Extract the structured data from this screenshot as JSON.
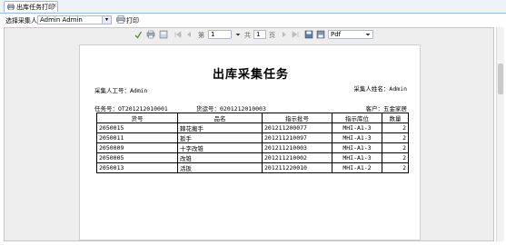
{
  "tab": {
    "label": "出库任务打印",
    "close": "×"
  },
  "filter": {
    "label": "选择采集人",
    "value": "Admin Admin",
    "arrow": "▾",
    "print_label": "打印"
  },
  "viewer_toolbar": {
    "page_prefix": "第",
    "page_value": "1",
    "total_prefix": "共",
    "total_value": "1",
    "total_suffix": "页",
    "format_value": "Pdf"
  },
  "report": {
    "title": "出库采集任务",
    "collector_id": "采集人工号：Admin",
    "collector_name": "采集人姓名：Admin",
    "task_no": "任务号：OT201212010001",
    "ship_no": "货运号：0201212010003",
    "customer": "客户：五金家居",
    "columns": [
      "货号",
      "品名",
      "指示批号",
      "指示库位",
      "数量"
    ],
    "rows": [
      [
        "2050015",
        "棘花搬手",
        "201211200077",
        "MHI-A1-3",
        "2"
      ],
      [
        "2050011",
        "扳手",
        "201211210097",
        "MHI-A1-3",
        "2"
      ],
      [
        "2050009",
        "十字改锥",
        "201211210003",
        "MHI-A1-3",
        "2"
      ],
      [
        "2050005",
        "改锥",
        "201211210002",
        "MHI-A1-3",
        "2"
      ],
      [
        "2050013",
        "活扳",
        "201211220010",
        "MHI-A1-2",
        "2"
      ]
    ]
  }
}
